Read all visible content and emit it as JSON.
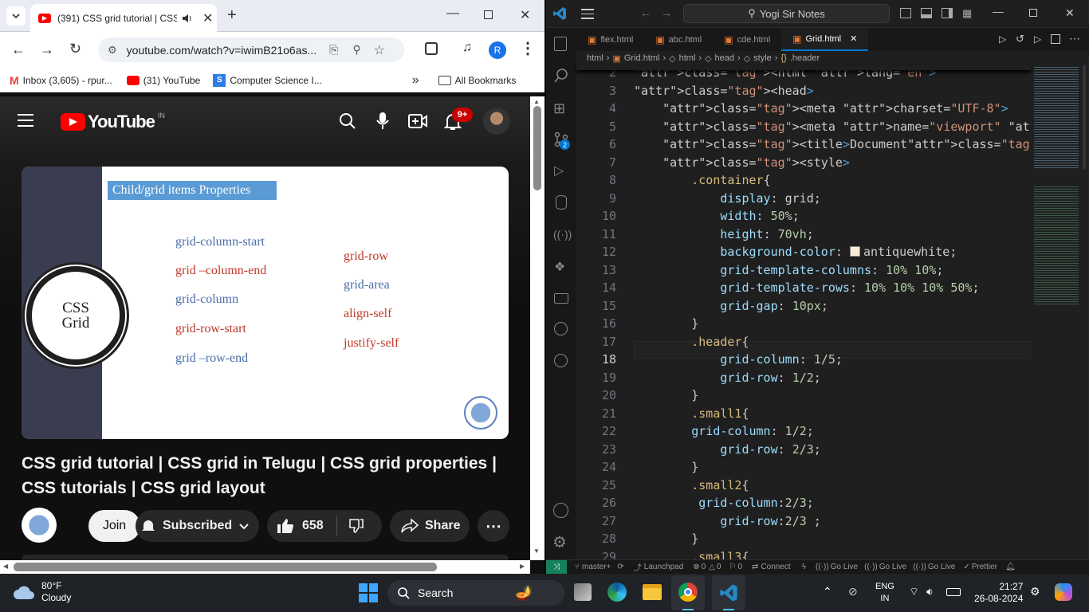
{
  "browser": {
    "tab_title": "(391) CSS grid tutorial | CSS",
    "url": "youtube.com/watch?v=iwimB21o6as...",
    "bookmarks": [
      {
        "label": "Inbox (3,605) - rpur..."
      },
      {
        "label": "(31) YouTube"
      },
      {
        "label": "Computer Science I..."
      }
    ],
    "all_bookmarks": "All Bookmarks",
    "profile_letter": "R"
  },
  "youtube": {
    "logo": "YouTube",
    "country": "IN",
    "notif_count": "9+",
    "video_title": "CSS grid tutorial | CSS grid in Telugu | CSS grid properties | CSS tutorials | CSS grid layout",
    "join": "Join",
    "subscribed": "Subscribed",
    "likes": "658",
    "share": "Share",
    "slide": {
      "heading": "Child/grid items Properties",
      "logo_text_1": "CSS",
      "logo_text_2": "Grid",
      "items_left": [
        "grid-column-start",
        "grid –column-end",
        "grid-column",
        "grid-row-start",
        "grid –row-end"
      ],
      "items_right": [
        "grid-row",
        "grid-area",
        "align-self",
        "justify-self"
      ]
    }
  },
  "vscode": {
    "search": "Yogi Sir Notes",
    "tabs": [
      {
        "label": "flex.html"
      },
      {
        "label": "abc.html"
      },
      {
        "label": "cde.html"
      },
      {
        "label": "Grid.html"
      }
    ],
    "breadcrumb": [
      "html",
      "Grid.html",
      "html",
      "head",
      "style",
      ".header"
    ],
    "scm_badge": "2",
    "code": [
      {
        "n": "2",
        "t": "<html lang=\"en\">"
      },
      {
        "n": "3",
        "t": "<head>"
      },
      {
        "n": "4",
        "t": "    <meta charset=\"UTF-8\">"
      },
      {
        "n": "5",
        "t": "    <meta name=\"viewport\" content=\"width=device-width,"
      },
      {
        "n": "6",
        "t": "    <title>Document</title>"
      },
      {
        "n": "7",
        "t": "    <style>"
      },
      {
        "n": "8",
        "t": "        .container{"
      },
      {
        "n": "9",
        "t": "            display: grid;"
      },
      {
        "n": "10",
        "t": "            width: 50%;"
      },
      {
        "n": "11",
        "t": "            height: 70vh;"
      },
      {
        "n": "12",
        "t": "            background-color:   antiquewhite;"
      },
      {
        "n": "13",
        "t": "            grid-template-columns: 10% 10%;"
      },
      {
        "n": "14",
        "t": "            grid-template-rows: 10% 10% 10% 50%;"
      },
      {
        "n": "15",
        "t": "            grid-gap: 10px;"
      },
      {
        "n": "16",
        "t": "        }"
      },
      {
        "n": "17",
        "t": "        .header{"
      },
      {
        "n": "18",
        "t": "            grid-column: 1/5;"
      },
      {
        "n": "19",
        "t": "            grid-row: 1/2;"
      },
      {
        "n": "20",
        "t": "        }"
      },
      {
        "n": "21",
        "t": "        .small1{"
      },
      {
        "n": "22",
        "t": "        grid-column: 1/2;"
      },
      {
        "n": "23",
        "t": "            grid-row: 2/3;"
      },
      {
        "n": "24",
        "t": "        }"
      },
      {
        "n": "25",
        "t": "        .small2{"
      },
      {
        "n": "26",
        "t": "         grid-column:2/3;"
      },
      {
        "n": "27",
        "t": "            grid-row:2/3 ;"
      },
      {
        "n": "28",
        "t": "        }"
      },
      {
        "n": "29",
        "t": "        .small3{"
      }
    ],
    "status": {
      "branch": "master+",
      "launchpad": "Launchpad",
      "errors": "0",
      "warnings": "0",
      "info": "0",
      "connect": "Connect",
      "golive": "Go Live",
      "prettier": "Prettier"
    }
  },
  "taskbar": {
    "temp": "80°F",
    "weather": "Cloudy",
    "search": "Search",
    "lang1": "ENG",
    "lang2": "IN",
    "time": "21:27",
    "date": "26-08-2024"
  }
}
